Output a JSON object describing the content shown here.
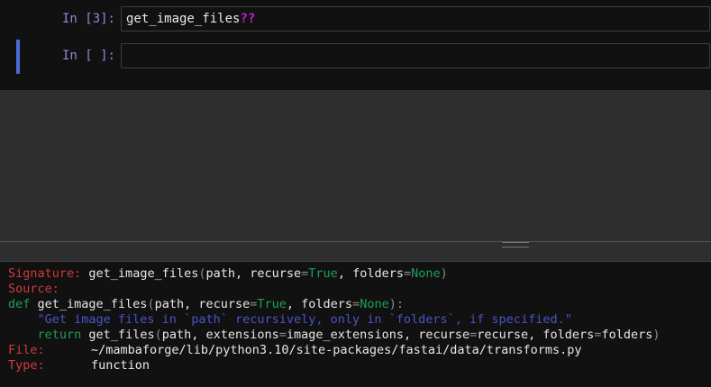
{
  "colors": {
    "background": "#2e2e2e",
    "cell_background": "#111111",
    "prompt": "#8a8ad8",
    "active_cell_marker": "#4a6ed8",
    "magic_qmarks": "#b622c8",
    "label_red": "#d33a3a",
    "keyword_green": "#1aa053",
    "string_blue": "#4b53c9"
  },
  "cells": [
    {
      "prompt": "In [3]:",
      "code": "get_image_files",
      "suffix": "??"
    },
    {
      "prompt": "In [ ]:",
      "code": "",
      "suffix": ""
    }
  ],
  "pager": {
    "signature_label": "Signature:",
    "signature_name": "get_image_files",
    "signature_open": "(",
    "signature_params_1": "path, recurse",
    "signature_eq_1": "=",
    "signature_true": "True",
    "signature_params_2": ", folders",
    "signature_eq_2": "=",
    "signature_none": "None",
    "signature_close": ")",
    "source_label": "Source:",
    "def_keyword": "def",
    "def_name": " get_image_files",
    "def_open": "(",
    "def_params_1": "path, recurse",
    "def_eq_1": "=",
    "def_true": "True",
    "def_params_2": ", folders",
    "def_eq_2": "=",
    "def_none": "None",
    "def_close": "):",
    "docstring": "    \"Get image files in `path` recursively, only in `folders`, if specified.\"",
    "return_indent": "    ",
    "return_keyword": "return",
    "return_call": " get_files",
    "return_open": "(",
    "return_arg_1": "path, extensions",
    "return_eq_1": "=",
    "return_arg_2": "image_extensions, recurse",
    "return_eq_2": "=",
    "return_arg_3": "recurse, folders",
    "return_eq_3": "=",
    "return_arg_4": "folders",
    "return_close": ")",
    "file_label": "File:",
    "file_path": "~/mambaforge/lib/python3.10/site-packages/fastai/data/transforms.py",
    "type_label": "Type:",
    "type_value": "function"
  }
}
